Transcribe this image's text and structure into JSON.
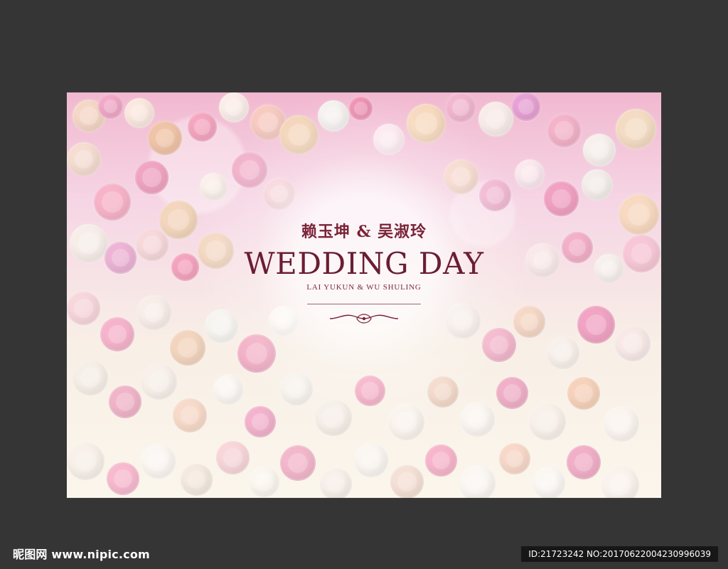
{
  "poster": {
    "chinese_names": "赖玉坤 & 吴淑玲",
    "title": "WEDDING DAY",
    "english_names": "LAI YUKUN & WU SHULING"
  },
  "watermark": {
    "site": "昵图网 www.nipic.com",
    "id_text": "ID:21723242 NO:20170622004230996039"
  },
  "colors": {
    "background": "#353535",
    "accent": "#6a1d32",
    "watermark_bar": "#171717"
  }
}
